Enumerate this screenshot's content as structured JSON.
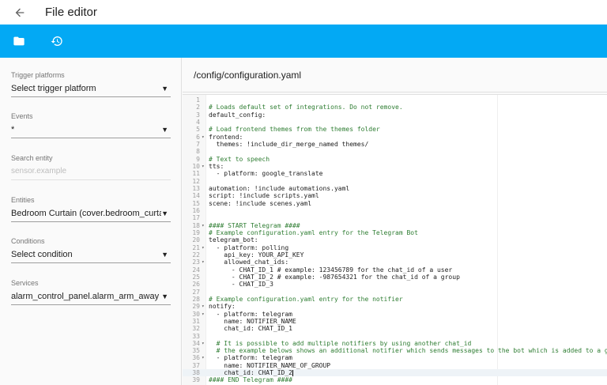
{
  "app": {
    "title": "File editor"
  },
  "toolbar": {
    "folder_icon": "folder-icon",
    "history_icon": "history-icon",
    "accent": "#03a9f4"
  },
  "sidebar": {
    "trigger": {
      "label": "Trigger platforms",
      "value": "Select trigger platform"
    },
    "events": {
      "label": "Events",
      "value": "*"
    },
    "search": {
      "label": "Search entity",
      "placeholder": "sensor.example"
    },
    "entities": {
      "label": "Entities",
      "value": "Bedroom Curtain (cover.bedroom_curtain)"
    },
    "conditions": {
      "label": "Conditions",
      "value": "Select condition"
    },
    "services": {
      "label": "Services",
      "value": "alarm_control_panel.alarm_arm_away"
    }
  },
  "editor": {
    "path": "/config/configuration.yaml",
    "lines": [
      {
        "n": "1",
        "t": "",
        "c": false,
        "f": ""
      },
      {
        "n": "2",
        "t": "# Loads default set of integrations. Do not remove.",
        "c": true,
        "f": ""
      },
      {
        "n": "3",
        "t": "default_config:",
        "c": false,
        "f": ""
      },
      {
        "n": "4",
        "t": "",
        "c": false,
        "f": ""
      },
      {
        "n": "5",
        "t": "# Load frontend themes from the themes folder",
        "c": true,
        "f": ""
      },
      {
        "n": "6",
        "t": "frontend:",
        "c": false,
        "f": "▾"
      },
      {
        "n": "7",
        "t": "  themes: !include_dir_merge_named themes/",
        "c": false,
        "f": ""
      },
      {
        "n": "8",
        "t": "",
        "c": false,
        "f": ""
      },
      {
        "n": "9",
        "t": "# Text to speech",
        "c": true,
        "f": ""
      },
      {
        "n": "10",
        "t": "tts:",
        "c": false,
        "f": "▾"
      },
      {
        "n": "11",
        "t": "  - platform: google_translate",
        "c": false,
        "f": ""
      },
      {
        "n": "12",
        "t": "",
        "c": false,
        "f": ""
      },
      {
        "n": "13",
        "t": "automation: !include automations.yaml",
        "c": false,
        "f": ""
      },
      {
        "n": "14",
        "t": "script: !include scripts.yaml",
        "c": false,
        "f": ""
      },
      {
        "n": "15",
        "t": "scene: !include scenes.yaml",
        "c": false,
        "f": ""
      },
      {
        "n": "16",
        "t": "",
        "c": false,
        "f": ""
      },
      {
        "n": "17",
        "t": "",
        "c": false,
        "f": ""
      },
      {
        "n": "18",
        "t": "#### START Telegram ####",
        "c": true,
        "f": "▾"
      },
      {
        "n": "19",
        "t": "# Example configuration.yaml entry for the Telegram Bot",
        "c": true,
        "f": ""
      },
      {
        "n": "20",
        "t": "telegram_bot:",
        "c": false,
        "f": ""
      },
      {
        "n": "21",
        "t": "  - platform: polling",
        "c": false,
        "f": "▾"
      },
      {
        "n": "22",
        "t": "    api_key: YOUR_API_KEY",
        "c": false,
        "f": ""
      },
      {
        "n": "23",
        "t": "    allowed_chat_ids:",
        "c": false,
        "f": "▾"
      },
      {
        "n": "24",
        "t": "      - CHAT_ID_1 # example: 123456789 for the chat_id of a user",
        "c": false,
        "f": ""
      },
      {
        "n": "25",
        "t": "      - CHAT_ID_2 # example: -987654321 for the chat_id of a group",
        "c": false,
        "f": ""
      },
      {
        "n": "26",
        "t": "      - CHAT_ID_3",
        "c": false,
        "f": ""
      },
      {
        "n": "27",
        "t": "",
        "c": false,
        "f": ""
      },
      {
        "n": "28",
        "t": "# Example configuration.yaml entry for the notifier",
        "c": true,
        "f": ""
      },
      {
        "n": "29",
        "t": "notify:",
        "c": false,
        "f": "▾"
      },
      {
        "n": "30",
        "t": "  - platform: telegram",
        "c": false,
        "f": "▾"
      },
      {
        "n": "31",
        "t": "    name: NOTIFIER_NAME",
        "c": false,
        "f": ""
      },
      {
        "n": "32",
        "t": "    chat_id: CHAT_ID_1",
        "c": false,
        "f": ""
      },
      {
        "n": "33",
        "t": "",
        "c": false,
        "f": ""
      },
      {
        "n": "34",
        "t": "  # It is possible to add multiple notifiers by using another chat_id",
        "c": true,
        "f": "▾"
      },
      {
        "n": "35",
        "t": "  # the example belows shows an additional notifier which sends messages to the bot which is added to a group",
        "c": true,
        "f": ""
      },
      {
        "n": "36",
        "t": "  - platform: telegram",
        "c": false,
        "f": "▾"
      },
      {
        "n": "37",
        "t": "    name: NOTIFIER_NAME_OF_GROUP",
        "c": false,
        "f": ""
      },
      {
        "n": "38",
        "t": "    chat_id: CHAT_ID_2",
        "c": false,
        "f": "",
        "active": true
      },
      {
        "n": "39",
        "t": "#### END Telegram ####",
        "c": true,
        "f": ""
      }
    ]
  }
}
